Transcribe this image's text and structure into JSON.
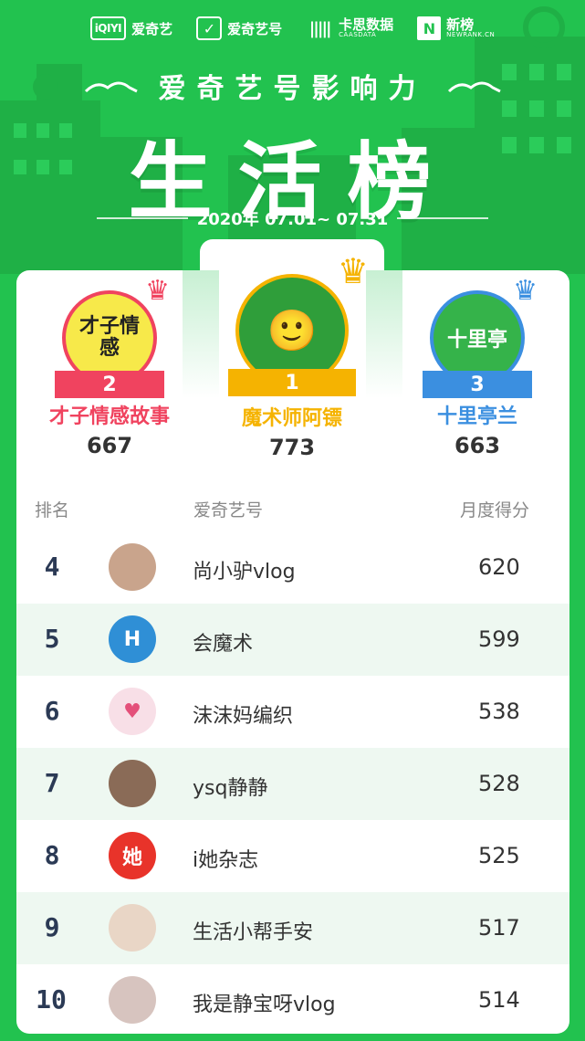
{
  "partners": [
    {
      "logo": "iQIYI",
      "label": "爱奇艺",
      "sub": ""
    },
    {
      "logo": "✓",
      "label": "爱奇艺号",
      "sub": ""
    },
    {
      "logo": "|||||",
      "label": "卡思数据",
      "sub": "CAASDATA"
    },
    {
      "logo": "N",
      "label": "新榜",
      "sub": "NEWRANK.CN"
    }
  ],
  "header": {
    "subtitle": "爱奇艺号影响力",
    "title": "生活榜",
    "date_range": "2020年 07.01~ 07.31"
  },
  "podium": [
    {
      "rank": "2",
      "name": "才子情感故事",
      "score": "667",
      "avatar_text": "才子情感",
      "color": "#f0435f",
      "ribbon_color": "#f0435f",
      "avatar_bg": "#f7e94a",
      "avatar_text_color": "#222"
    },
    {
      "rank": "1",
      "name": "魔术师阿镖",
      "score": "773",
      "avatar_text": "🙂",
      "color": "#f5b301",
      "ribbon_color": "#f5b301",
      "avatar_bg": "#2f9e3a",
      "avatar_text_color": "#fff"
    },
    {
      "rank": "3",
      "name": "十里亭兰",
      "score": "663",
      "avatar_text": "十里亭",
      "color": "#3b8fe0",
      "ribbon_color": "#3b8fe0",
      "avatar_bg": "#35b34a",
      "avatar_text_color": "#fff"
    }
  ],
  "table": {
    "col_rank": "排名",
    "col_account": "爱奇艺号",
    "col_score": "月度得分",
    "rows": [
      {
        "rank": "4",
        "name": "尚小驴vlog",
        "score": "620",
        "avatar_text": "",
        "avatar_bg": "#c9a48c"
      },
      {
        "rank": "5",
        "name": "会魔术",
        "score": "599",
        "avatar_text": "H",
        "avatar_bg": "#2f8fd6"
      },
      {
        "rank": "6",
        "name": "沫沫妈编织",
        "score": "538",
        "avatar_text": "♥",
        "avatar_bg": "#f8dfe7"
      },
      {
        "rank": "7",
        "name": "ysq静静",
        "score": "528",
        "avatar_text": "",
        "avatar_bg": "#8a6b57"
      },
      {
        "rank": "8",
        "name": "i她杂志",
        "score": "525",
        "avatar_text": "她",
        "avatar_bg": "#e8332a"
      },
      {
        "rank": "9",
        "name": "生活小帮手安",
        "score": "517",
        "avatar_text": "",
        "avatar_bg": "#e9d6c6"
      },
      {
        "rank": "10",
        "name": "我是静宝呀vlog",
        "score": "514",
        "avatar_text": "",
        "avatar_bg": "#d7c4bf"
      }
    ]
  }
}
